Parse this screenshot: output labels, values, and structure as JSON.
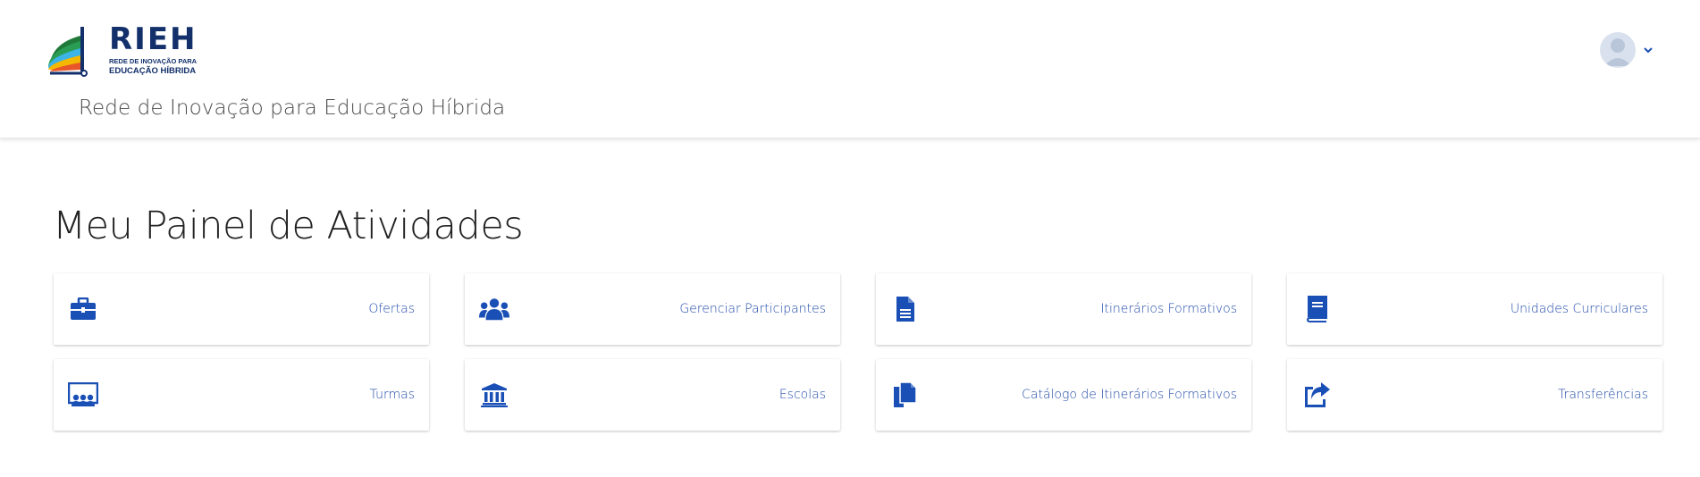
{
  "header": {
    "logo": {
      "big": "RIEH",
      "line1": "REDE DE INOVAÇÃO PARA",
      "line2": "EDUCAÇÃO HÍBRIDA"
    },
    "subtitle": "Rede de Inovação para Educação Híbrida",
    "user_menu": {
      "avatar_icon": "user-avatar-icon",
      "chevron_icon": "chevron-down-icon"
    }
  },
  "main": {
    "title": "Meu Painel de Atividades",
    "cards": [
      {
        "label": "Ofertas",
        "icon": "briefcase-icon"
      },
      {
        "label": "Gerenciar Participantes",
        "icon": "users-icon"
      },
      {
        "label": "Itinerários Formativos",
        "icon": "document-icon"
      },
      {
        "label": "Unidades Curriculares",
        "icon": "book-icon"
      },
      {
        "label": "Turmas",
        "icon": "classroom-icon"
      },
      {
        "label": "Escolas",
        "icon": "school-building-icon"
      },
      {
        "label": "Catálogo de Itinerários Formativos",
        "icon": "documents-copy-icon"
      },
      {
        "label": "Transferências",
        "icon": "share-arrow-icon"
      }
    ]
  },
  "colors": {
    "brand": "#13306b",
    "card_text": "#1f4aa8",
    "icon": "#1a4fb5"
  }
}
